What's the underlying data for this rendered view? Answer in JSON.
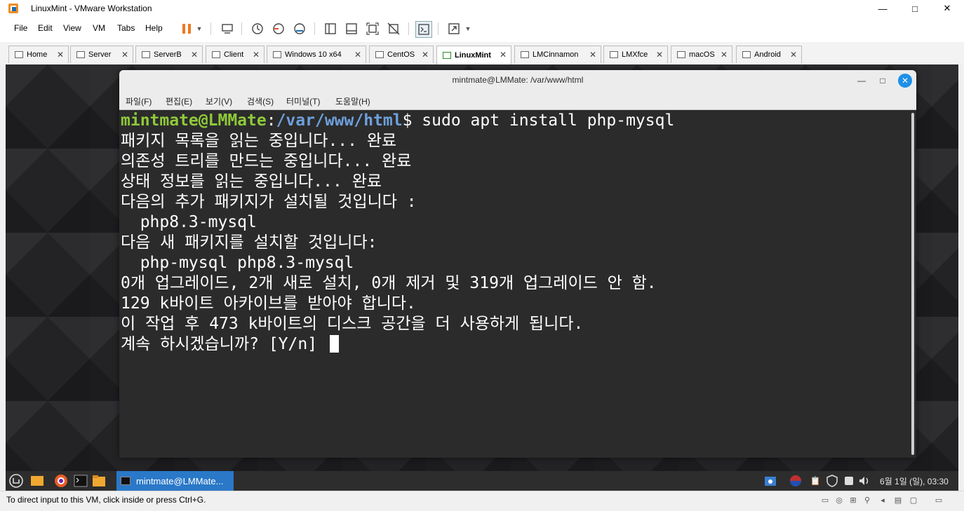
{
  "window": {
    "title": "LinuxMint - VMware Workstation",
    "controls": [
      "—",
      "□",
      "✕"
    ]
  },
  "menu": [
    "File",
    "Edit",
    "View",
    "VM",
    "Tabs",
    "Help"
  ],
  "tabs": [
    {
      "label": "Home"
    },
    {
      "label": "Server"
    },
    {
      "label": "ServerB"
    },
    {
      "label": "Client"
    },
    {
      "label": "Windows 10 x64"
    },
    {
      "label": "CentOS"
    },
    {
      "label": "LinuxMint",
      "active": true
    },
    {
      "label": "LMCinnamon"
    },
    {
      "label": "LMXfce"
    },
    {
      "label": "macOS"
    },
    {
      "label": "Android"
    }
  ],
  "terminal": {
    "title": "mintmate@LMMate: /var/www/html",
    "menu": [
      "파일(F)",
      "편집(E)",
      "보기(V)",
      "검색(S)",
      "터미널(T)",
      "도움말(H)"
    ],
    "prompt_user": "mintmate@LMMate",
    "prompt_sep": ":",
    "prompt_path": "/var/www/html",
    "prompt_end": "$ ",
    "command": "sudo apt install php-mysql",
    "lines": [
      "패키지 목록을 읽는 중입니다... 완료",
      "의존성 트리를 만드는 중입니다... 완료",
      "상태 정보를 읽는 중입니다... 완료",
      "다음의 추가 패키지가 설치될 것입니다 :",
      "  php8.3-mysql",
      "다음 새 패키지를 설치할 것입니다:",
      "  php-mysql php8.3-mysql",
      "0개 업그레이드, 2개 새로 설치, 0개 제거 및 319개 업그레이드 안 함.",
      "129 k바이트 아카이브를 받아야 합니다.",
      "이 작업 후 473 k바이트의 디스크 공간을 더 사용하게 됩니다."
    ],
    "question": "계속 하시겠습니까? [Y/n] "
  },
  "taskbar": {
    "active_task": "mintmate@LMMate...",
    "clock": "6월 1일 (일), 03:30"
  },
  "status": {
    "text": "To direct input to this VM, click inside or press Ctrl+G."
  },
  "colors": {
    "prompt_user": "#8fc93a",
    "prompt_path": "#6ea0dc",
    "terminal_bg": "#2b2b2b",
    "accent": "#2a78c8"
  }
}
